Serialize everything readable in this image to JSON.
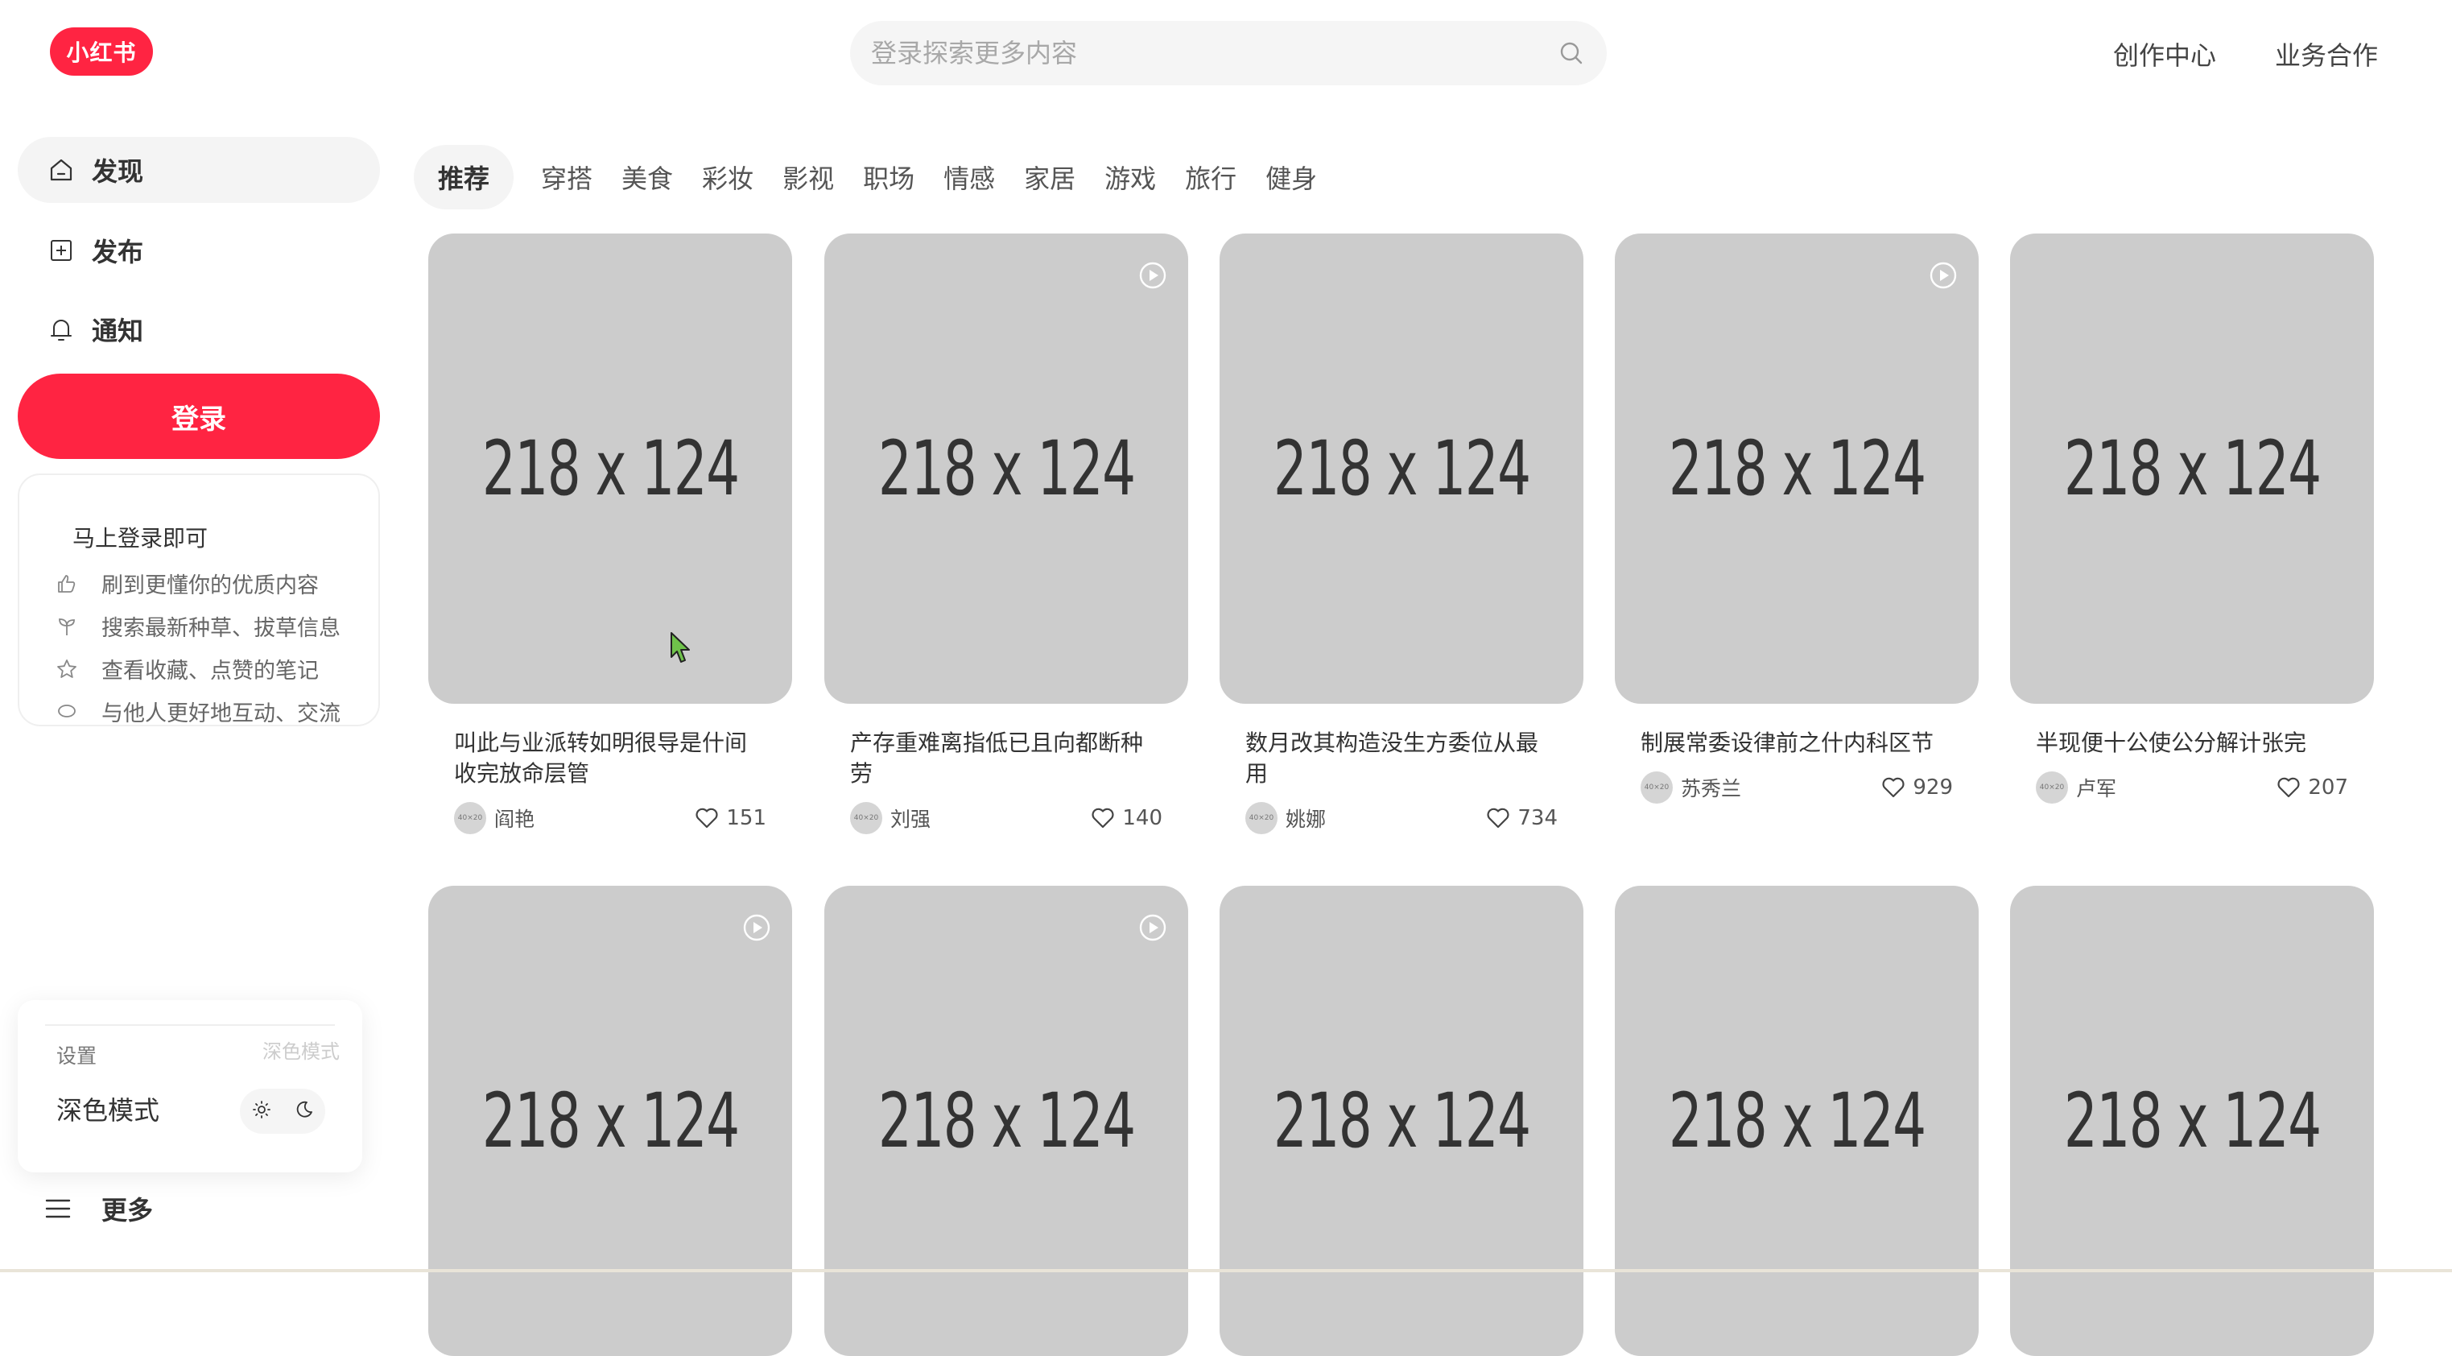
{
  "header": {
    "logo_text": "小红书",
    "search_placeholder": "登录探索更多内容",
    "links": [
      "创作中心",
      "业务合作"
    ]
  },
  "sidebar": {
    "items": [
      {
        "label": "发现",
        "icon": "home-icon",
        "active": true
      },
      {
        "label": "发布",
        "icon": "plus-square-icon",
        "active": false
      },
      {
        "label": "通知",
        "icon": "bell-icon",
        "active": false
      }
    ],
    "login_label": "登录",
    "login_card": {
      "title": "马上登录即可",
      "benefits": [
        {
          "text": "刷到更懂你的优质内容",
          "icon": "thumbs-up-icon"
        },
        {
          "text": "搜索最新种草、拔草信息",
          "icon": "sprout-icon"
        },
        {
          "text": "查看收藏、点赞的笔记",
          "icon": "star-icon"
        },
        {
          "text": "与他人更好地互动、交流",
          "icon": "chat-bubble-icon"
        }
      ]
    },
    "settings": {
      "label": "设置",
      "ghost_label": "深色模式",
      "dark_mode_label": "深色模式"
    },
    "more_label": "更多"
  },
  "channels": [
    "推荐",
    "穿搭",
    "美食",
    "彩妆",
    "影视",
    "职场",
    "情感",
    "家居",
    "游戏",
    "旅行",
    "健身"
  ],
  "feed": [
    {
      "title": "叫此与业派转如明很导是什间收完放命层管",
      "author": "阎艳",
      "likes": "151",
      "video": false,
      "placeholder": "218 x 124"
    },
    {
      "title": "产存重难离指低已且向都断种劳",
      "author": "刘强",
      "likes": "140",
      "video": true,
      "placeholder": "218 x 124"
    },
    {
      "title": "数月改其构造没生方委位从最用",
      "author": "姚娜",
      "likes": "734",
      "video": false,
      "placeholder": "218 x 124"
    },
    {
      "title": "制展常委设律前之什内科区节",
      "author": "苏秀兰",
      "likes": "929",
      "video": true,
      "placeholder": "218 x 124"
    },
    {
      "title": "半现便十公使公分解计张完",
      "author": "卢军",
      "likes": "207",
      "video": false,
      "placeholder": "218 x 124"
    },
    {
      "placeholder": "218 x 124",
      "video": true
    },
    {
      "placeholder": "218 x 124",
      "video": true
    },
    {
      "placeholder": "218 x 124",
      "video": false
    },
    {
      "placeholder": "218 x 124",
      "video": false
    },
    {
      "placeholder": "218 x 124",
      "video": false
    }
  ],
  "avatar_placeholder": "40×20",
  "colors": {
    "brand": "#ff2442",
    "cover": "#cccccc"
  }
}
